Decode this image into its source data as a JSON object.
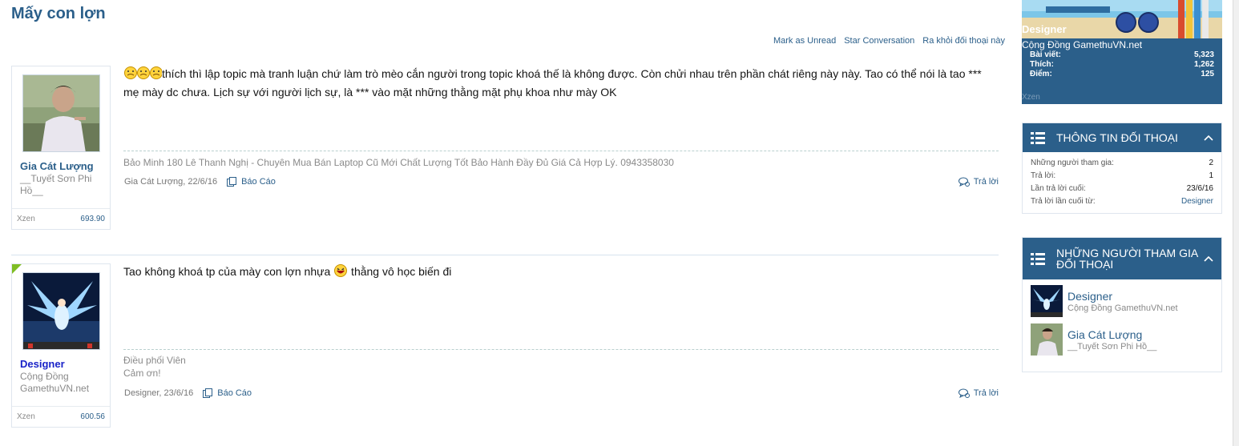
{
  "page_title": "Mấy con lợn",
  "conversation_actions": [
    "Mark as Unread",
    "Star Conversation",
    "Ra khỏi đối thoại này"
  ],
  "messages": [
    {
      "author": "Gia Cát Lượng",
      "author_title": "__Tuyết Sơn Phi Hồ__",
      "footer_label": "Xzen",
      "footer_value": "693.90",
      "text": "thích thì lập topic mà tranh luận chứ làm trò mèo cắn người trong topic khoá thế là không được. Còn chửi nhau trên phần chát riêng này này. Tao có thể nói là tao *** mẹ mày dc chưa. Lịch sự với người lịch sự, là *** vào mặt những thằng mặt phụ khoa như mày OK",
      "signature": "Bảo Minh 180 Lê Thanh Nghị - Chuyên Mua Bán Laptop Cũ Mới Chất Lượng Tốt Bảo Hành Đầy Đủ Giá Cả Hợp Lý. 0943358030",
      "meta": "Gia Cát Lượng, 22/6/16",
      "report_label": "Báo Cáo",
      "reply_label": "Trả lời"
    },
    {
      "author": "Designer",
      "author_title": "Cộng Đồng GamethuVN.net",
      "footer_label": "Xzen",
      "footer_value": "600.56",
      "text_before": "Tao không khoá tp của mày con lợn nhựa",
      "text_after": " thằng vô học biến đi",
      "signature": "Điều phối Viên\nCảm ơn!",
      "meta": "Designer, 23/6/16",
      "report_label": "Báo Cáo",
      "reply_label": "Trả lời"
    }
  ],
  "sidebar": {
    "profile": {
      "name": "Designer",
      "title": "Cộng Đồng GamethuVN.net",
      "stats": [
        {
          "label": "Bài viết:",
          "value": "5,323"
        },
        {
          "label": "Thích:",
          "value": "1,262"
        },
        {
          "label": "Điểm:",
          "value": "125"
        }
      ],
      "footer": "Xzen"
    },
    "info_block": {
      "title": "THÔNG TIN ĐỐI THOẠI",
      "rows": [
        {
          "label": "Những người tham gia:",
          "value": "2"
        },
        {
          "label": "Trả lời:",
          "value": "1"
        },
        {
          "label": "Lần trả lời cuối:",
          "value": "23/6/16"
        },
        {
          "label": "Trả lời lần cuối từ:",
          "value": "Designer"
        }
      ]
    },
    "participants_block": {
      "title": "NHỮNG NGƯỜI THAM GIA ĐỐI THOẠI",
      "participants": [
        {
          "name": "Designer",
          "title": "Cộng Đồng GamethuVN.net"
        },
        {
          "name": "Gia Cát Lượng",
          "title": "__Tuyết Sơn Phi Hồ__"
        }
      ]
    }
  },
  "colors": {
    "accent": "#2b5f8a",
    "link": "#2b5f8a",
    "author_designer": "#1a23c8",
    "badge_green": "#7fbd24"
  }
}
